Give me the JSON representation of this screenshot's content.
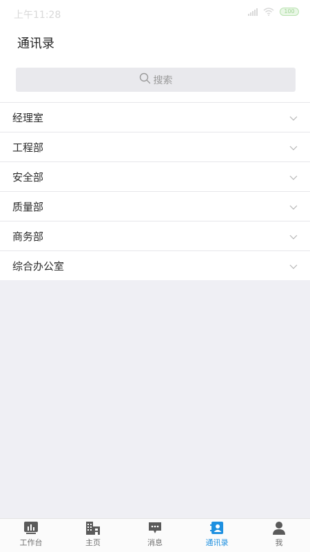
{
  "status_bar": {
    "time": "上午11:28",
    "battery": "100"
  },
  "header": {
    "title": "通讯录"
  },
  "search": {
    "placeholder": "搜索"
  },
  "departments": [
    {
      "label": "经理室"
    },
    {
      "label": "工程部"
    },
    {
      "label": "安全部"
    },
    {
      "label": "质量部"
    },
    {
      "label": "商务部"
    },
    {
      "label": "综合办公室"
    }
  ],
  "tabs": [
    {
      "label": "工作台",
      "icon": "chart-icon"
    },
    {
      "label": "主页",
      "icon": "building-icon"
    },
    {
      "label": "消息",
      "icon": "message-icon"
    },
    {
      "label": "通讯录",
      "icon": "contacts-icon",
      "active": true
    },
    {
      "label": "我",
      "icon": "person-icon"
    }
  ],
  "colors": {
    "accent": "#1e90e0",
    "tab_inactive": "#5a5a5a",
    "background": "#efeff4"
  }
}
